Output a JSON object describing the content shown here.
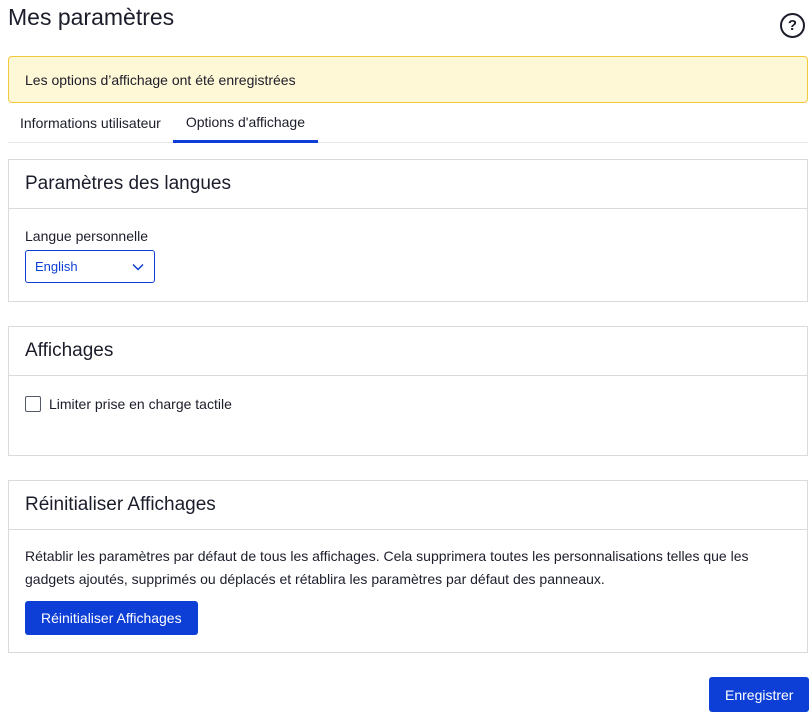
{
  "page": {
    "title": "Mes paramètres"
  },
  "help": {
    "glyph": "?"
  },
  "banner": {
    "message": "Les options d’affichage ont été enregistrées"
  },
  "tabs": [
    {
      "label": "Informations utilisateur",
      "active": false
    },
    {
      "label": "Options d'affichage",
      "active": true
    }
  ],
  "language_section": {
    "title": "Paramètres des langues",
    "field_label": "Langue personnelle",
    "selected": "English"
  },
  "displays_section": {
    "title": "Affichages",
    "checkbox_label": "Limiter prise en charge tactile",
    "checked": false
  },
  "reset_section": {
    "title": "Réinitialiser Affichages",
    "description": "Rétablir les paramètres par défaut de tous les affichages. Cela supprimera toutes les personnalisations telles que les gadgets ajoutés, supprimés ou déplacés et rétablira les paramètres par défaut des panneaux.",
    "button_label": "Réinitialiser Affichages"
  },
  "footer": {
    "save_label": "Enregistrer"
  },
  "colors": {
    "accent": "#0d3fd6",
    "banner_bg": "#fff8d6",
    "banner_border": "#f0c93c"
  }
}
